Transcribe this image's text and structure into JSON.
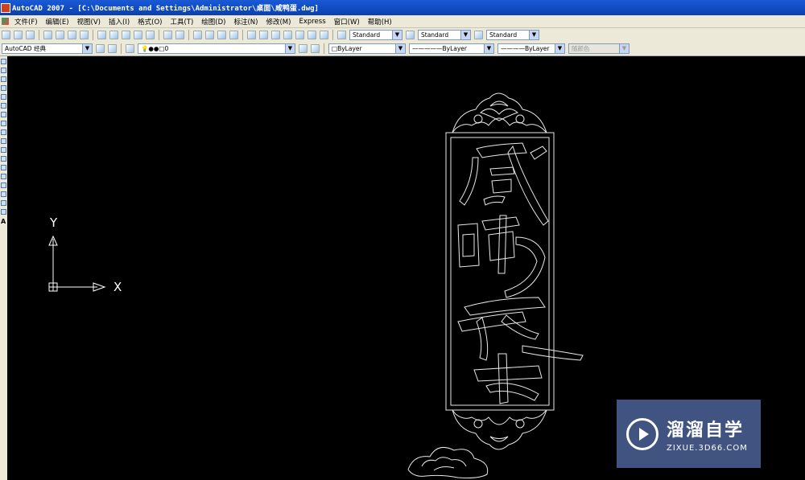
{
  "title": "AutoCAD 2007 - [C:\\Documents and Settings\\Administrator\\桌面\\咸鸭蛋.dwg]",
  "menus": [
    "文件(F)",
    "编辑(E)",
    "视图(V)",
    "插入(I)",
    "格式(O)",
    "工具(T)",
    "绘图(D)",
    "标注(N)",
    "修改(M)",
    "Express",
    "窗口(W)",
    "帮助(H)"
  ],
  "toolbar": {
    "text_style": "Standard",
    "dim_style": "Standard",
    "table_style": "Standard"
  },
  "properties": {
    "workspace": "AutoCAD 经典",
    "layer": "0",
    "color": "ByLayer",
    "linetype": "ByLayer",
    "lineweight": "ByLayer",
    "plotstyle": "随颜色"
  },
  "canvas": {
    "ucs_x": "X",
    "ucs_y": "Y",
    "drawing_text": "咸鸭蛋"
  },
  "watermark": {
    "brand": "溜溜自学",
    "url": "ZIXUE.3D66.COM"
  },
  "colors": {
    "canvas": "#000000",
    "toolbar": "#ece9d8",
    "titlebar": "#0a3fb0"
  }
}
